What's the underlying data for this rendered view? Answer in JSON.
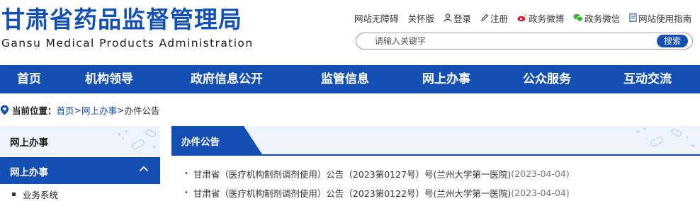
{
  "header": {
    "logo_cn": "甘肃省药品监督管理局",
    "logo_en": "Gansu Medical Products Administration"
  },
  "toplinks": [
    {
      "label": "网站无障碍",
      "icon": ""
    },
    {
      "label": "关怀版",
      "icon": ""
    },
    {
      "label": "登录",
      "icon": "user-icon"
    },
    {
      "label": "注册",
      "icon": "pencil-icon"
    },
    {
      "label": "政务微博",
      "icon": "weibo-icon"
    },
    {
      "label": "政务微信",
      "icon": "wechat-icon"
    },
    {
      "label": "网站使用指南",
      "icon": "guide-icon"
    }
  ],
  "search": {
    "placeholder": "请输入关键字",
    "button": "搜索"
  },
  "nav": [
    "首页",
    "机构领导",
    "政府信息公开",
    "监管信息",
    "网上办事",
    "公众服务",
    "互动交流"
  ],
  "breadcrumb": {
    "label": "当前位置：",
    "items": [
      "首页",
      "网上办事"
    ],
    "separator": ">",
    "current": "办件公告"
  },
  "sidebar": {
    "title": "网上办事",
    "section": "网上办事",
    "items": [
      "业务系统"
    ]
  },
  "panel": {
    "title": "办件公告",
    "items": [
      {
        "title": "甘肃省（医疗机构制剂调剂使用）公告（2023第0127号）号(兰州大学第一医院)",
        "date": "(2023-04-04)"
      },
      {
        "title": "甘肃省（医疗机构制剂调剂使用）公告（2023第0122号）号(兰州大学第一医院)",
        "date": "(2023-04-04)"
      }
    ]
  },
  "colors": {
    "brand": "#1450b4",
    "light_bg": "#eef4fb"
  }
}
